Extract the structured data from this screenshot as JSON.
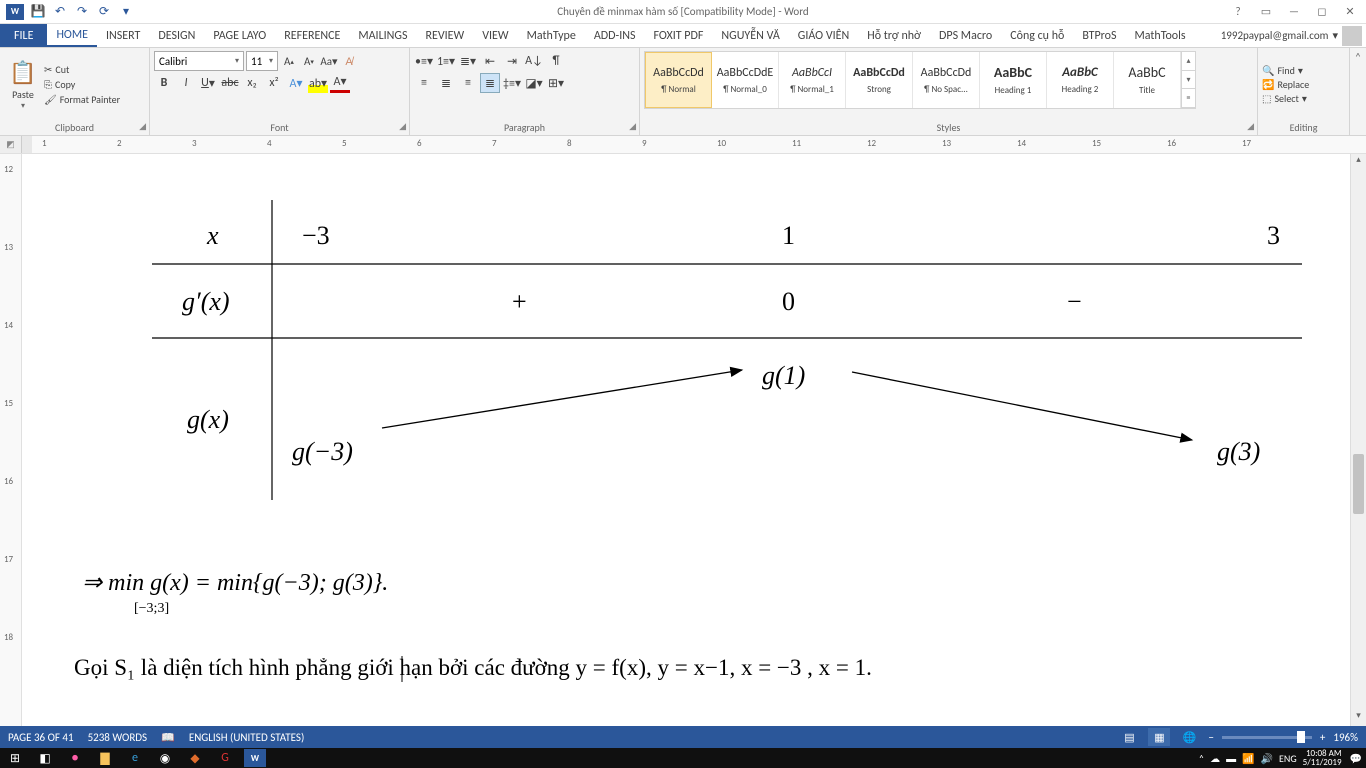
{
  "titlebar": {
    "title": "Chuyên đề minmax hàm số [Compatibility Mode] - Word"
  },
  "account": {
    "email": "1992paypal@gmail.com"
  },
  "tabs": {
    "file": "FILE",
    "items": [
      "HOME",
      "INSERT",
      "DESIGN",
      "PAGE LAYO",
      "REFERENCE",
      "MAILINGS",
      "REVIEW",
      "VIEW",
      "MathType",
      "ADD-INS",
      "FOXIT PDF",
      "NGUYỄN VĂ",
      "GIÁO VIÊN",
      "Hỗ trợ nhờ",
      "DPS Macro",
      "Công cụ hỗ",
      "BTProS",
      "MathTools"
    ],
    "active": 0
  },
  "ribbon": {
    "clipboard": {
      "label": "Clipboard",
      "paste": "Paste",
      "cut": "Cut",
      "copy": "Copy",
      "fmt": "Format Painter"
    },
    "font": {
      "label": "Font",
      "name": "Calibri",
      "size": "11"
    },
    "paragraph": {
      "label": "Paragraph"
    },
    "styles": {
      "label": "Styles",
      "items": [
        {
          "preview": "AaBbCcDd",
          "name": "¶ Normal",
          "sel": true
        },
        {
          "preview": "AaBbCcDdE",
          "name": "¶ Normal_0"
        },
        {
          "preview": "AaBbCcI",
          "name": "¶ Normal_1"
        },
        {
          "preview": "AaBbCcDd",
          "name": "Strong"
        },
        {
          "preview": "AaBbCcDd",
          "name": "¶ No Spac..."
        },
        {
          "preview": "AaBbC",
          "name": "Heading 1"
        },
        {
          "preview": "AaBbC",
          "name": "Heading 2"
        },
        {
          "preview": "AaBbC",
          "name": "Title"
        }
      ]
    },
    "editing": {
      "label": "Editing",
      "find": "Find",
      "replace": "Replace",
      "select": "Select"
    }
  },
  "ruler": {
    "marks": [
      1,
      2,
      3,
      4,
      5,
      6,
      7,
      8,
      9,
      10,
      11,
      12,
      13,
      14,
      15,
      16,
      17
    ]
  },
  "vruler": {
    "marks": [
      12,
      13,
      14,
      15,
      16,
      17,
      18
    ]
  },
  "document": {
    "table": {
      "row1": {
        "c0": "x",
        "c1": "−3",
        "c2": "1",
        "c3": "3"
      },
      "row2": {
        "c0": "g′(x)",
        "c1": "+",
        "c2": "0",
        "c3": "−"
      },
      "row3": {
        "c0": "g(x)",
        "left": "g(−3)",
        "mid": "g(1)",
        "right": "g(3)"
      }
    },
    "eq1": "⇒ min g(x) = min{g(−3); g(3)}.",
    "eq1_sub": "[−3;3]",
    "text_line": "Gọi  S₁  là diện tích hình phẳng giới hạn bởi các đường  y = f(x),  y = x−1,  x = −3 ,  x = 1."
  },
  "status": {
    "page": "PAGE 36 OF 41",
    "words": "5238 WORDS",
    "lang": "ENGLISH (UNITED STATES)",
    "zoom": "196%"
  },
  "taskbar": {
    "time": "10:08 AM",
    "date": "5/11/2019",
    "lang": "ENG"
  }
}
